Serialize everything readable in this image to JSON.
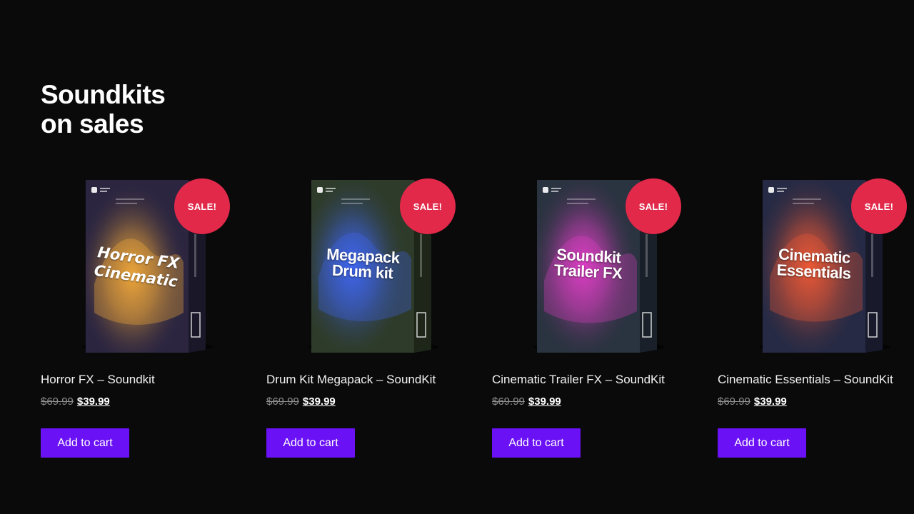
{
  "section": {
    "title_line1": "Soundkits",
    "title_line2": "on sales"
  },
  "products": [
    {
      "name": "Horror FX – Soundkit",
      "box_title": "Horror FX Cinematic",
      "sale_badge": "SALE!",
      "old_price": "$69.99",
      "new_price": "$39.99",
      "cart_label": "Add to cart",
      "box_color": "#2b2540",
      "glow_color": "#f2a83a"
    },
    {
      "name": "Drum Kit Megapack – SoundKit",
      "box_title": "Megapack Drum kit",
      "sale_badge": "SALE!",
      "old_price": "$69.99",
      "new_price": "$39.99",
      "cart_label": "Add to cart",
      "box_color": "#2e3b2a",
      "glow_color": "#3f66f5"
    },
    {
      "name": "Cinematic Trailer FX – SoundKit",
      "box_title": "Soundkit Trailer FX",
      "sale_badge": "SALE!",
      "old_price": "$69.99",
      "new_price": "$39.99",
      "cart_label": "Add to cart",
      "box_color": "#2a3340",
      "glow_color": "#e23fc8"
    },
    {
      "name": "Cinematic Essentials – SoundKit",
      "box_title": "Cinematic Essentials",
      "sale_badge": "SALE!",
      "old_price": "$69.99",
      "new_price": "$39.99",
      "cart_label": "Add to cart",
      "box_color": "#262a44",
      "glow_color": "#f25a35"
    }
  ],
  "colors": {
    "background": "#0a0a0b",
    "sale_badge": "#e2294a",
    "button": "#6a12f5"
  }
}
